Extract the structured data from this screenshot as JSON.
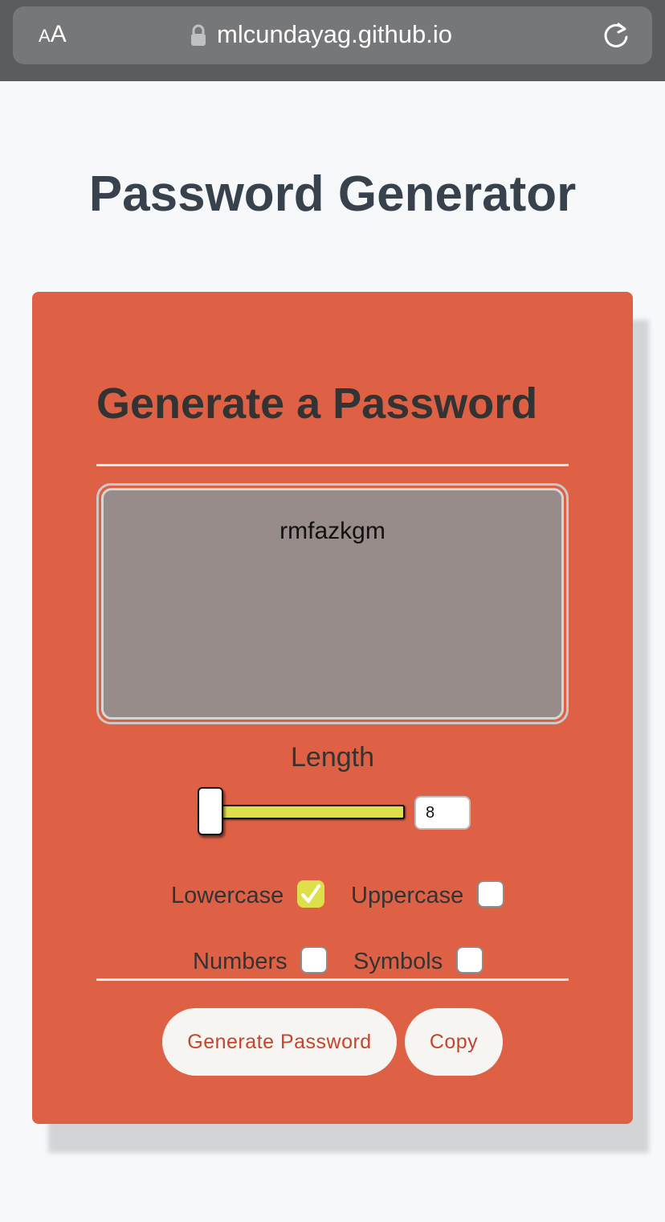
{
  "browser": {
    "text_size_label": "AA",
    "url": "mlcundayag.github.io"
  },
  "page": {
    "title": "Password Generator"
  },
  "card": {
    "heading": "Generate a Password",
    "password_value": "rmfazkgm",
    "length": {
      "label": "Length",
      "value": "8"
    },
    "options": [
      {
        "label": "Lowercase",
        "checked": true
      },
      {
        "label": "Uppercase",
        "checked": false
      },
      {
        "label": "Numbers",
        "checked": false
      },
      {
        "label": "Symbols",
        "checked": false
      }
    ],
    "buttons": {
      "generate": "Generate Password",
      "copy": "Copy"
    }
  },
  "colors": {
    "card_bg": "#df6145",
    "accent": "#dde04a",
    "title_text": "#37424d",
    "button_text": "#c4452c",
    "password_box_bg": "#978c89"
  },
  "icons": {
    "lock": "lock-icon",
    "reload": "reload-icon",
    "check": "checkmark-icon"
  }
}
